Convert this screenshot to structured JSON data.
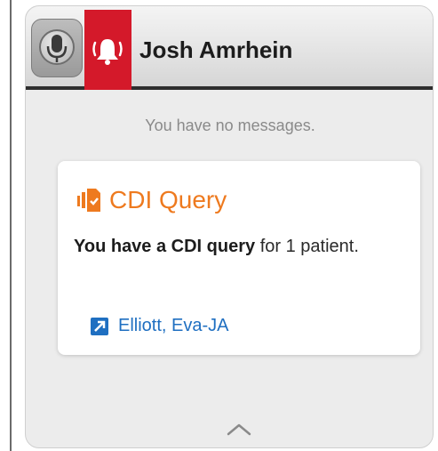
{
  "header": {
    "user_name": "Josh Amrhein",
    "mic_icon": "microphone-icon",
    "alert_icon": "alarm-bell-icon",
    "alert_color": "#d4192a"
  },
  "messages": {
    "empty_text": "You have no messages."
  },
  "notification": {
    "title": "CDI Query",
    "title_icon": "document-query-icon",
    "title_color": "#ee7a1f",
    "body_bold": "You have a CDI query",
    "body_rest": " for 1 patient.",
    "patient_link": "Elliott, Eva-JA",
    "link_icon": "open-link-icon",
    "link_color": "#1f6fc1"
  },
  "footer": {
    "collapse_icon": "chevron-up-icon"
  }
}
